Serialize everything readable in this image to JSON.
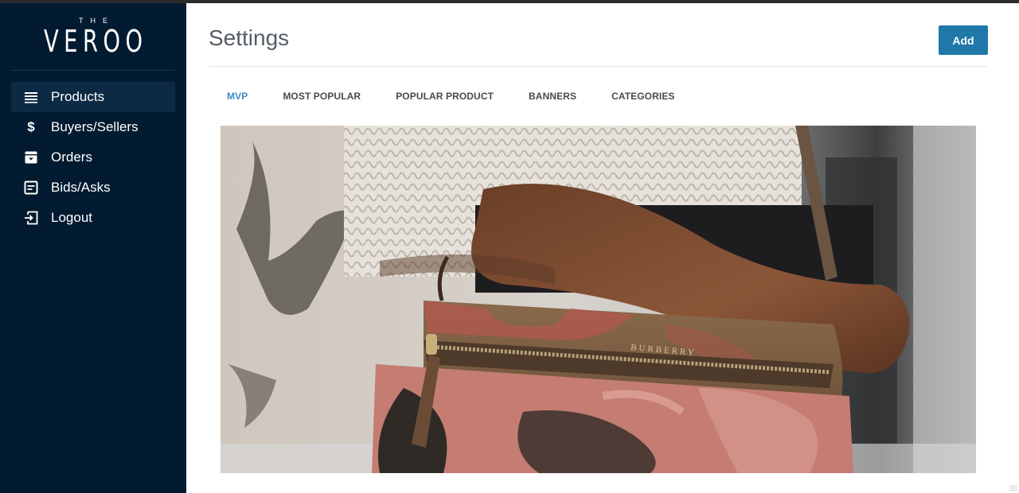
{
  "brand": {
    "small": "THE",
    "name": "VEROO"
  },
  "sidebar": {
    "items": [
      {
        "label": "Products",
        "icon": "list-icon",
        "active": true
      },
      {
        "label": "Buyers/Sellers",
        "icon": "dollar-icon",
        "active": false
      },
      {
        "label": "Orders",
        "icon": "archive-icon",
        "active": false
      },
      {
        "label": "Bids/Asks",
        "icon": "document-icon",
        "active": false
      },
      {
        "label": "Logout",
        "icon": "logout-icon",
        "active": false
      }
    ]
  },
  "header": {
    "title": "Settings",
    "add_label": "Add"
  },
  "tabs": [
    {
      "label": "MVP",
      "active": true
    },
    {
      "label": "MOST POPULAR",
      "active": false
    },
    {
      "label": "POPULAR PRODUCT",
      "active": false
    },
    {
      "label": "BANNERS",
      "active": false
    },
    {
      "label": "CATEGORIES",
      "active": false
    }
  ],
  "banner": {
    "bag_text": "BURBERRY"
  },
  "colors": {
    "sidebar_bg": "#031b30",
    "sidebar_active": "#0d2a44",
    "accent": "#1f78a8",
    "tab_active": "#3a8dc0"
  }
}
